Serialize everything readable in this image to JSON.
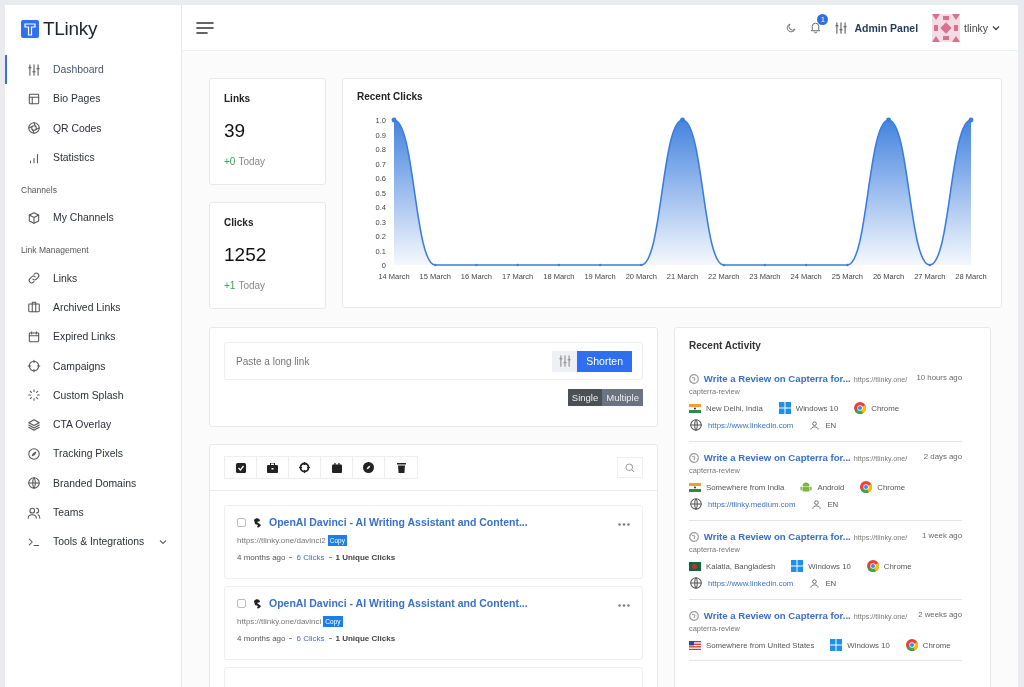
{
  "brand": {
    "name": "TLinky"
  },
  "sidebar": {
    "items": [
      {
        "kind": "item",
        "label": "Dashboard",
        "selected": true
      },
      {
        "kind": "item",
        "label": "Bio Pages",
        "selected": false
      },
      {
        "kind": "item",
        "label": "QR Codes",
        "selected": false
      },
      {
        "kind": "item",
        "label": "Statistics",
        "selected": false
      },
      {
        "kind": "heading",
        "label": "Channels"
      },
      {
        "kind": "item",
        "label": "My Channels",
        "selected": false
      },
      {
        "kind": "heading",
        "label": "Link Management"
      },
      {
        "kind": "item",
        "label": "Links",
        "selected": false
      },
      {
        "kind": "item",
        "label": "Archived Links",
        "selected": false
      },
      {
        "kind": "item",
        "label": "Expired Links",
        "selected": false
      },
      {
        "kind": "item",
        "label": "Campaigns",
        "selected": false
      },
      {
        "kind": "item",
        "label": "Custom Splash",
        "selected": false
      },
      {
        "kind": "item",
        "label": "CTA Overlay",
        "selected": false
      },
      {
        "kind": "item",
        "label": "Tracking Pixels",
        "selected": false
      },
      {
        "kind": "item",
        "label": "Branded Domains",
        "selected": false
      },
      {
        "kind": "item",
        "label": "Teams",
        "selected": false
      },
      {
        "kind": "item",
        "label": "Tools & Integrations",
        "selected": false,
        "expanded": false
      }
    ]
  },
  "header": {
    "notification_count": "1",
    "admin_label": "Admin Panel",
    "user_name": "tlinky"
  },
  "stats": [
    {
      "title": "Links",
      "value": "39",
      "delta": "+0",
      "delta_label": "Today"
    },
    {
      "title": "Clicks",
      "value": "1252",
      "delta": "+1",
      "delta_label": "Today"
    }
  ],
  "recent_clicks": {
    "title": "Recent Clicks",
    "chart_data": {
      "type": "area",
      "categories": [
        "14 March",
        "15 March",
        "16 March",
        "17 March",
        "18 March",
        "19 March",
        "20 March",
        "21 March",
        "22 March",
        "23 March",
        "24 March",
        "25 March",
        "26 March",
        "27 March",
        "28 March"
      ],
      "series": [
        {
          "color": "#3b7ddd",
          "values": [
            1,
            0,
            0,
            0,
            0,
            0,
            0,
            1,
            0,
            0,
            0,
            0,
            1,
            0,
            1
          ]
        }
      ],
      "ylim": [
        0,
        1
      ],
      "yticks": [
        0,
        0.1,
        0.2,
        0.3,
        0.4,
        0.5,
        0.6,
        0.7,
        0.8,
        0.9,
        {
          "value": 1,
          "label": "1.0"
        }
      ]
    }
  },
  "shortener": {
    "placeholder": "Paste a long link",
    "button": "Shorten",
    "modes": [
      {
        "label": "Single",
        "selected": true
      },
      {
        "label": "Multiple",
        "selected": false
      }
    ]
  },
  "links": [
    {
      "title": "OpenAI Davinci - AI Writing Assistant and Content...",
      "url": "https://tlinky.one/davinci2",
      "copy": "Copy",
      "time": "4 months ago",
      "clicks": "6 Clicks",
      "unique": "1 Unique Clicks",
      "checked": false
    },
    {
      "title": "OpenAI Davinci - AI Writing Assistant and Content...",
      "url": "https://tlinky.one/davinci",
      "copy": "Copy",
      "time": "4 months ago",
      "clicks": "6 Clicks",
      "unique": "1 Unique Clicks",
      "checked": false
    }
  ],
  "recent_activity": {
    "title": "Recent Activity",
    "items": [
      {
        "title": "Write a Review on Capterra for...",
        "url": "https://tlinky.one/",
        "url_rest": "capterra-review",
        "time": "10 hours ago",
        "location": "New Delhi, India",
        "os": "Windows 10",
        "browser": "Chrome",
        "referrer": "https://www.linkedin.com",
        "language": "EN"
      },
      {
        "title": "Write a Review on Capterra for...",
        "url": "https://tlinky.one/",
        "url_rest": "capterra-review",
        "time": "2 days ago",
        "location": "Somewhere from India",
        "os": "Android",
        "browser": "Chrome",
        "referrer": "https://tlinky.medium.com",
        "language": "EN"
      },
      {
        "title": "Write a Review on Capterra for...",
        "url": "https://tlinky.one/",
        "url_rest": "capterra-review",
        "time": "1 week ago",
        "location": "Kalatia, Bangladesh",
        "os": "Windows 10",
        "browser": "Chrome",
        "referrer": "https://www.linkedin.com",
        "language": "EN"
      },
      {
        "title": "Write a Review on Capterra for...",
        "url": "https://tlinky.one/",
        "url_rest": "capterra-review",
        "time": "2 weeks ago",
        "location": "Somewhere from United States",
        "os": "Windows 10",
        "browser": "Chrome"
      }
    ]
  }
}
